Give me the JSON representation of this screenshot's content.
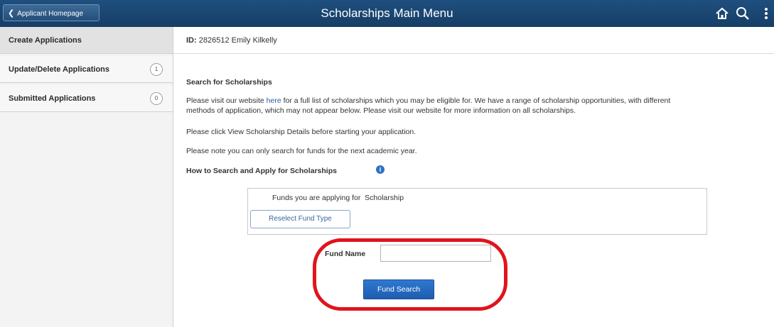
{
  "header": {
    "back_label": "Applicant Homepage",
    "title": "Scholarships Main Menu",
    "icons": [
      "home-icon",
      "search-icon",
      "more-icon"
    ]
  },
  "sidebar": {
    "items": [
      {
        "label": "Create Applications"
      },
      {
        "label": "Update/Delete Applications",
        "count": "1"
      },
      {
        "label": "Submitted Applications",
        "count": "0"
      }
    ]
  },
  "student": {
    "id_label": "ID:",
    "id_value": "2826512",
    "name": "Emily Kilkelly"
  },
  "content": {
    "search_heading": "Search for Scholarships",
    "para1_before": "Please visit our website ",
    "para1_link": "here",
    "para1_after": " for a full list of scholarships which you may be eligible for. We have a range of scholarship opportunities, with different",
    "para1_line2": "methods of application, which may not appear below. Please visit our website for more information on all scholarships.",
    "para2": "Please click View Scholarship Details before starting your application.",
    "para3": "Please note you can only search for funds for the next academic year.",
    "how_to_heading": "How to Search and Apply for Scholarships"
  },
  "fund_type": {
    "label": "Funds you are applying for",
    "value": "Scholarship",
    "reselect_label": "Reselect Fund Type"
  },
  "fund_search": {
    "name_label": "Fund Name",
    "name_value": "",
    "button_label": "Fund Search"
  },
  "colors": {
    "header_bg": "#1f4f7f",
    "primary_button": "#2f79d0",
    "highlight": "#e0141e"
  }
}
